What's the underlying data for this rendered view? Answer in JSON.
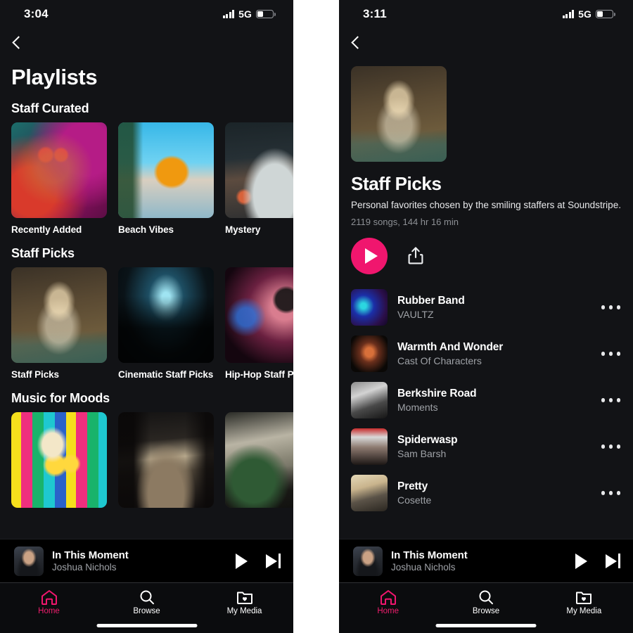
{
  "left": {
    "status": {
      "time": "3:04",
      "network": "5G",
      "signal_icon": "cellular-signal-icon",
      "battery_icon": "battery-icon"
    },
    "back_label": "back-chevron",
    "page_title": "Playlists",
    "sections": [
      {
        "title": "Staff Curated",
        "cards": [
          {
            "label": "Recently Added",
            "art": "a-recent"
          },
          {
            "label": "Beach Vibes",
            "art": "a-beach"
          },
          {
            "label": "Mystery",
            "art": "a-mystery"
          }
        ]
      },
      {
        "title": "Staff Picks",
        "cards": [
          {
            "label": "Staff Picks",
            "art": "a-staff"
          },
          {
            "label": "Cinematic Staff Picks",
            "art": "a-cinema"
          },
          {
            "label": "Hip-Hop Staff Picks",
            "art": "a-hiphop"
          }
        ]
      },
      {
        "title": "Music for Moods",
        "cards": [
          {
            "label": "",
            "art": "a-mood1"
          },
          {
            "label": "",
            "art": "a-mood2"
          },
          {
            "label": "",
            "art": "a-mood3"
          }
        ]
      }
    ],
    "mini_player": {
      "title": "In This Moment",
      "artist": "Joshua Nichols",
      "play_icon": "play-icon",
      "next_icon": "next-track-icon"
    },
    "tabs": [
      {
        "label": "Home",
        "icon": "home-icon",
        "active": true
      },
      {
        "label": "Browse",
        "icon": "search-icon",
        "active": false
      },
      {
        "label": "My Media",
        "icon": "folder-heart-icon",
        "active": false
      }
    ]
  },
  "right": {
    "status": {
      "time": "3:11",
      "network": "5G",
      "signal_icon": "cellular-signal-icon",
      "battery_icon": "battery-icon"
    },
    "back_label": "back-chevron",
    "detail": {
      "cover_art": "a-staff",
      "title": "Staff Picks",
      "description": "Personal favorites chosen by the smiling staffers at Soundstripe.",
      "meta": "2119 songs, 144 hr 16 min",
      "play_icon": "play-icon",
      "share_icon": "share-icon"
    },
    "tracks": [
      {
        "name": "Rubber Band",
        "artist": "VAULTZ",
        "art": "t-rubber"
      },
      {
        "name": "Warmth And Wonder",
        "artist": "Cast Of Characters",
        "art": "t-warmth"
      },
      {
        "name": "Berkshire Road",
        "artist": "Moments",
        "art": "t-berkshire"
      },
      {
        "name": "Spiderwasp",
        "artist": "Sam Barsh",
        "art": "t-spider"
      },
      {
        "name": "Pretty",
        "artist": "Cosette",
        "art": "t-pretty"
      }
    ],
    "mini_player": {
      "title": "In This Moment",
      "artist": "Joshua Nichols",
      "play_icon": "play-icon",
      "next_icon": "next-track-icon"
    },
    "tabs": [
      {
        "label": "Home",
        "icon": "home-icon",
        "active": true
      },
      {
        "label": "Browse",
        "icon": "search-icon",
        "active": false
      },
      {
        "label": "My Media",
        "icon": "folder-heart-icon",
        "active": false
      }
    ]
  },
  "colors": {
    "accent": "#f0166e",
    "background": "#121316",
    "tabbar": "#0b0c0e",
    "muted_text": "#9fa2a7"
  }
}
